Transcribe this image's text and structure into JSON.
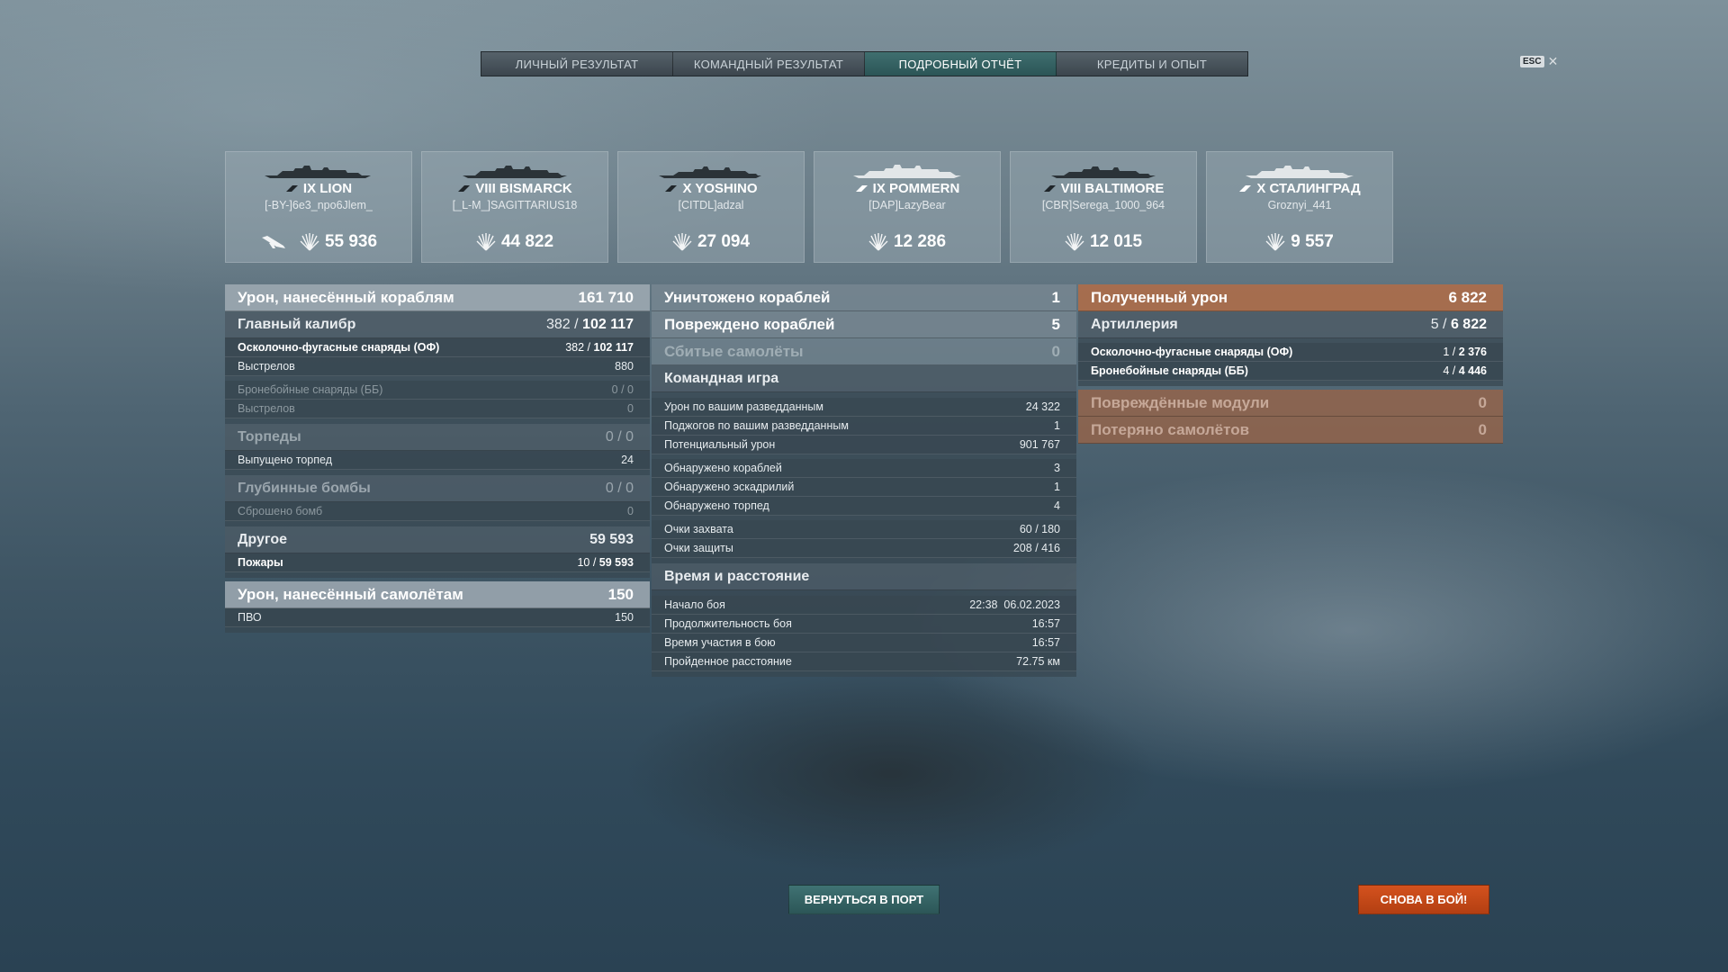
{
  "tabs": [
    {
      "label": "ЛИЧНЫЙ РЕЗУЛЬТАТ"
    },
    {
      "label": "КОМАНДНЫЙ РЕЗУЛЬТАТ"
    },
    {
      "label": "ПОДРОБНЫЙ ОТЧЁТ",
      "active": true
    },
    {
      "label": "КРЕДИТЫ И ОПЫТ"
    }
  ],
  "esc": {
    "key": "ESC",
    "close": "✕"
  },
  "ships": [
    {
      "name": "IX LION",
      "player": "[-BY-]6e3_npo6Jlem_",
      "damage": "55 936",
      "plane_icon": true
    },
    {
      "name": "VIII BISMARCK",
      "player": "[_L-M_]SAGITTARIUS18",
      "damage": "44 822"
    },
    {
      "name": "X YOSHINO",
      "player": "[CITDL]adzal",
      "damage": "27 094"
    },
    {
      "name": "IX POMMERN",
      "player": "[DAP]LazyBear",
      "damage": "12 286"
    },
    {
      "name": "VIII BALTIMORE",
      "player": "[CBR]Serega_1000_964",
      "damage": "12 015"
    },
    {
      "name": "X СТАЛИНГРАД",
      "player": "Groznyi_441",
      "damage": "9 557"
    }
  ],
  "left": {
    "ship_damage": {
      "label": "Урон, нанесённый кораблям",
      "value": "161 710"
    },
    "main_caliber": {
      "label": "Главный калибр",
      "hits": "382",
      "dmg": "102 117"
    },
    "he": {
      "label": "Осколочно-фугасные снаряды (ОФ)",
      "hits": "382",
      "dmg": "102 117"
    },
    "he_shots": {
      "label": "Выстрелов",
      "value": "880"
    },
    "ap": {
      "label": "Бронебойные снаряды (ББ)",
      "value": "0 / 0"
    },
    "ap_shots": {
      "label": "Выстрелов",
      "value": "0"
    },
    "torpedoes": {
      "label": "Торпеды",
      "value": "0 / 0"
    },
    "torp_launched": {
      "label": "Выпущено торпед",
      "value": "24"
    },
    "depth": {
      "label": "Глубинные бомбы",
      "value": "0 / 0"
    },
    "depth_dropped": {
      "label": "Сброшено бомб",
      "value": "0"
    },
    "other": {
      "label": "Другое",
      "value": "59 593"
    },
    "fires": {
      "label": "Пожары",
      "hits": "10",
      "dmg": "59 593"
    },
    "plane_damage": {
      "label": "Урон, нанесённый самолётам",
      "value": "150"
    },
    "aa": {
      "label": "ПВО",
      "value": "150"
    }
  },
  "middle": {
    "destroyed": {
      "label": "Уничтожено кораблей",
      "value": "1"
    },
    "damaged": {
      "label": "Повреждено кораблей",
      "value": "5"
    },
    "planes_shot": {
      "label": "Сбитые самолёты",
      "value": "0"
    },
    "team_play": {
      "label": "Командная игра"
    },
    "spot_damage": {
      "label": "Урон по вашим разведданным",
      "value": "24 322"
    },
    "spot_fires": {
      "label": "Поджогов по вашим разведданным",
      "value": "1"
    },
    "potential": {
      "label": "Потенциальный урон",
      "value": "901 767"
    },
    "spotted_ships": {
      "label": "Обнаружено кораблей",
      "value": "3"
    },
    "spotted_squadrons": {
      "label": "Обнаружено эскадрилий",
      "value": "1"
    },
    "spotted_torps": {
      "label": "Обнаружено торпед",
      "value": "4"
    },
    "capture": {
      "label": "Очки захвата",
      "value": "60 / 180"
    },
    "defense": {
      "label": "Очки защиты",
      "value": "208 / 416"
    },
    "time_distance": {
      "label": "Время и расстояние"
    },
    "start": {
      "label": "Начало боя",
      "value": "22:38  06.02.2023"
    },
    "duration": {
      "label": "Продолжительность боя",
      "value": "16:57"
    },
    "participation": {
      "label": "Время участия в бою",
      "value": "16:57"
    },
    "distance": {
      "label": "Пройденное расстояние",
      "value": "72.75 км"
    }
  },
  "right": {
    "received": {
      "label": "Полученный урон",
      "value": "6 822"
    },
    "artillery": {
      "label": "Артиллерия",
      "hits": "5",
      "dmg": "6 822"
    },
    "he": {
      "label": "Осколочно-фугасные снаряды (ОФ)",
      "hits": "1",
      "dmg": "2 376"
    },
    "ap": {
      "label": "Бронебойные снаряды (ББ)",
      "hits": "4",
      "dmg": "4 446"
    },
    "modules": {
      "label": "Повреждённые модули",
      "value": "0"
    },
    "planes_lost": {
      "label": "Потеряно самолётов",
      "value": "0"
    }
  },
  "buttons": {
    "port": "ВЕРНУТЬСЯ В ПОРТ",
    "battle": "СНОВА В БОЙ!"
  },
  "colors": {
    "active_tab": "#2b5556",
    "battle_button": "#b33f12",
    "received_header": "#af6c48"
  }
}
